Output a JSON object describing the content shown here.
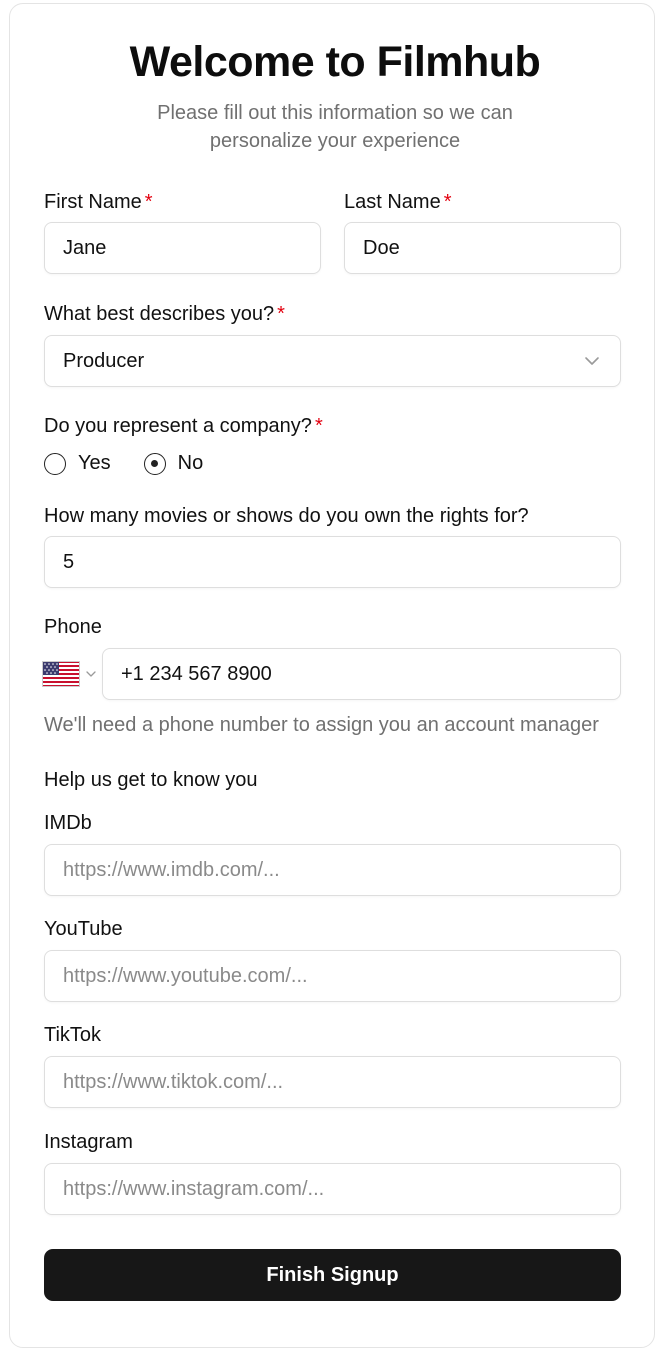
{
  "header": {
    "title": "Welcome to Filmhub",
    "subtitle_line1": "Please fill out this information so we can",
    "subtitle_line2": "personalize your experience"
  },
  "required_marker": "*",
  "first_name": {
    "label": "First Name",
    "value": "Jane"
  },
  "last_name": {
    "label": "Last Name",
    "value": "Doe"
  },
  "role": {
    "label": "What best describes you?",
    "selected": "Producer"
  },
  "company": {
    "label": "Do you represent a company?",
    "options": [
      {
        "label": "Yes",
        "checked": false
      },
      {
        "label": "No",
        "checked": true
      }
    ]
  },
  "titles_owned": {
    "label": "How many movies or shows do you own the rights for?",
    "value": "5"
  },
  "phone": {
    "label": "Phone",
    "country_icon": "us-flag-icon",
    "value": "+1 234 567 8900",
    "helper": "We'll need a phone number to assign you an account manager"
  },
  "social": {
    "heading": "Help us get to know you",
    "imdb": {
      "label": "IMDb",
      "placeholder": "https://www.imdb.com/..."
    },
    "youtube": {
      "label": "YouTube",
      "placeholder": "https://www.youtube.com/..."
    },
    "tiktok": {
      "label": "TikTok",
      "placeholder": "https://www.tiktok.com/..."
    },
    "instagram": {
      "label": "Instagram",
      "placeholder": "https://www.instagram.com/..."
    }
  },
  "submit": {
    "label": "Finish Signup"
  },
  "colors": {
    "accent_required": "#e3000f",
    "button_bg": "#171717",
    "muted_text": "#707070",
    "input_border": "#dedede"
  }
}
